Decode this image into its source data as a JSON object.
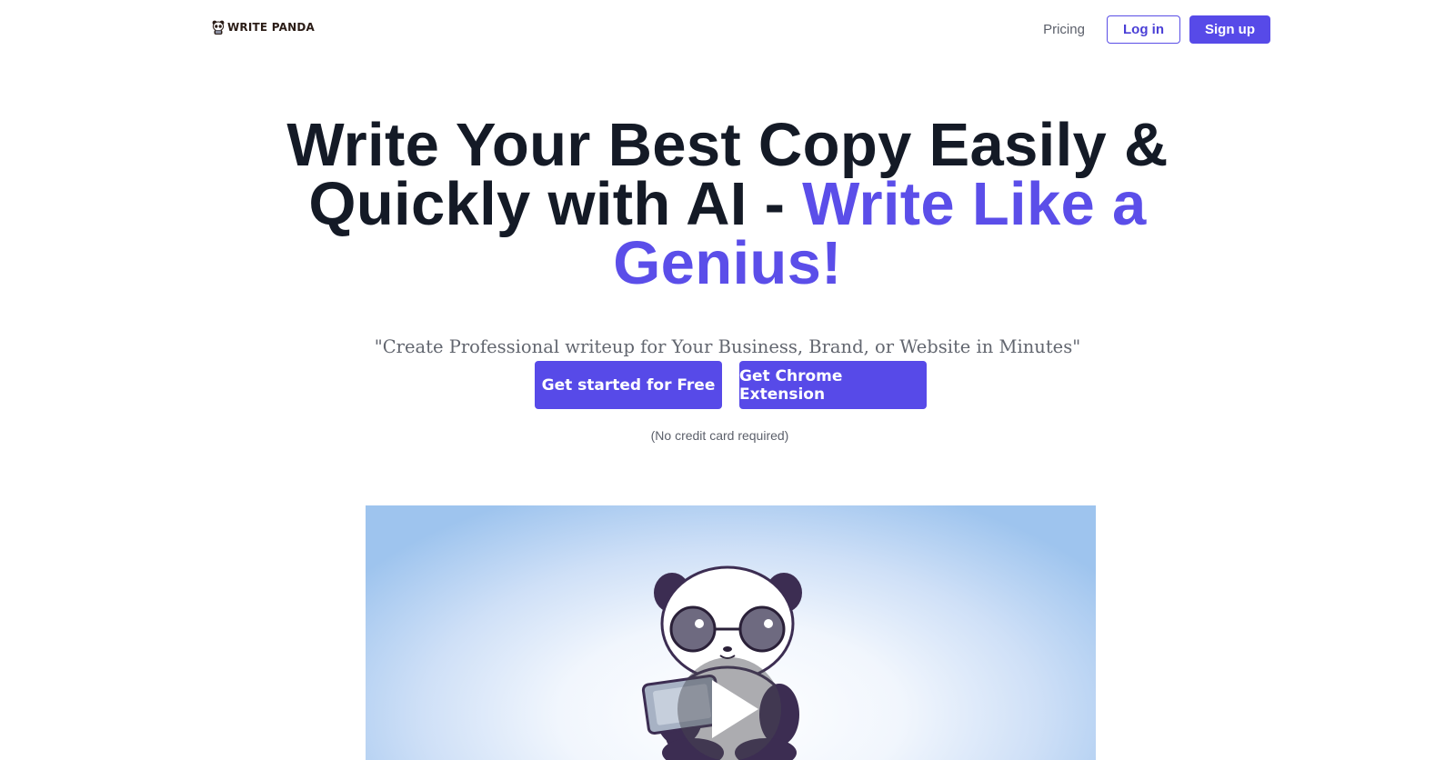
{
  "brand": {
    "name": "WRITE PANDA",
    "logo_icon": "panda-logo-icon"
  },
  "nav": {
    "pricing": "Pricing",
    "login": "Log in",
    "signup": "Sign up"
  },
  "hero": {
    "headline_line1": "Write Your Best Copy Easily &",
    "headline_line2a": "Quickly with AI - ",
    "headline_line2b": "Write Like a",
    "headline_line3": "Genius!",
    "subheadline": "\"Create Professional writeup for Your Business, Brand, or Website in Minutes\"",
    "cta_primary": "Get started for Free",
    "cta_secondary": "Get Chrome Extension",
    "note": "(No credit card required)"
  },
  "video": {
    "illustration": "panda-with-glasses-and-laptop",
    "play_icon": "play-icon"
  },
  "colors": {
    "accent": "#574ae8",
    "heading": "#141a26",
    "muted": "#62666f"
  }
}
